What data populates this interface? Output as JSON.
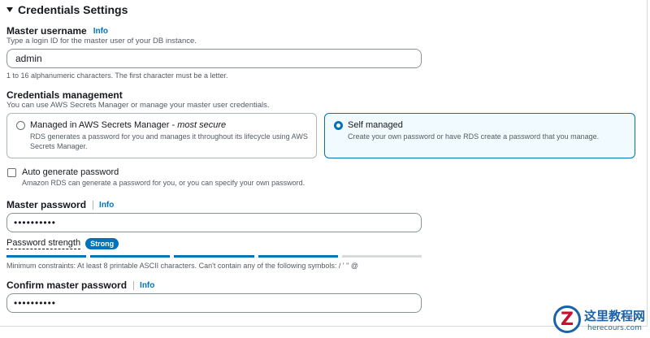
{
  "section": {
    "title": "Credentials Settings"
  },
  "master_username": {
    "label": "Master username",
    "info": "Info",
    "description": "Type a login ID for the master user of your DB instance.",
    "value": "admin",
    "constraint": "1 to 16 alphanumeric characters. The first character must be a letter."
  },
  "credentials_management": {
    "label": "Credentials management",
    "description": "You can use AWS Secrets Manager or manage your master user credentials.",
    "options": [
      {
        "title": "Managed in AWS Secrets Manager - ",
        "title_emphasis": "most secure",
        "description": "RDS generates a password for you and manages it throughout its lifecycle using AWS Secrets Manager.",
        "selected": false
      },
      {
        "title": "Self managed",
        "description": "Create your own password or have RDS create a password that you manage.",
        "selected": true
      }
    ]
  },
  "auto_generate": {
    "label": "Auto generate password",
    "description": "Amazon RDS can generate a password for you, or you can specify your own password.",
    "checked": false
  },
  "master_password": {
    "label": "Master password",
    "info": "Info",
    "value": "••••••••••"
  },
  "password_strength": {
    "label": "Password strength",
    "badge": "Strong",
    "level_filled_segments": 4,
    "total_segments": 5,
    "constraints": "Minimum constraints: At least 8 printable ASCII characters. Can't contain any of the following symbols: / ' \" @"
  },
  "confirm_password": {
    "label": "Confirm master password",
    "info": "Info",
    "value": "••••••••••"
  },
  "watermark": {
    "letter": "Z",
    "name": "这里教程网",
    "url": "herecours.com"
  },
  "colors": {
    "accent": "#0073bb",
    "text": "#16191f",
    "muted": "#545b64",
    "border": "#879596"
  }
}
